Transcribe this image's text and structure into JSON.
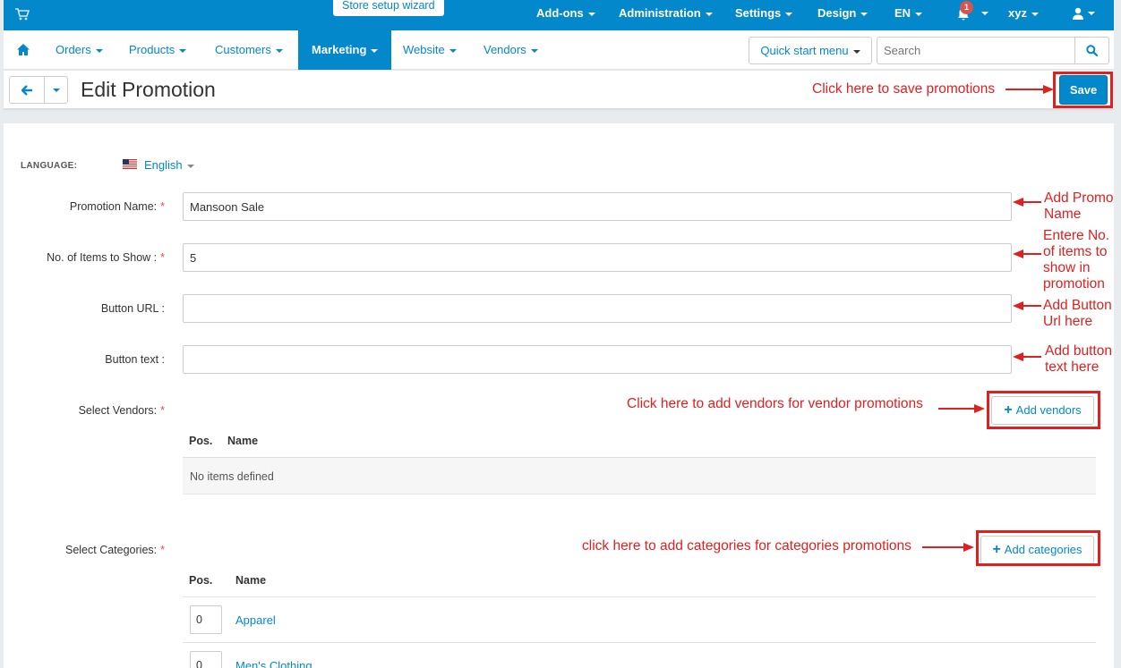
{
  "topbar": {
    "cart_icon": "shopping-cart-icon",
    "wizard_label": "Store setup wizard",
    "items": [
      {
        "label": "Add-ons"
      },
      {
        "label": "Administration"
      },
      {
        "label": "Settings"
      },
      {
        "label": "Design"
      },
      {
        "label": "EN"
      }
    ],
    "notification_count": "1",
    "user_name": "xyz"
  },
  "nav": {
    "home_icon": "home-icon",
    "items": [
      {
        "label": "Orders"
      },
      {
        "label": "Products"
      },
      {
        "label": "Customers"
      },
      {
        "label": "Marketing",
        "active": true
      },
      {
        "label": "Website"
      },
      {
        "label": "Vendors"
      }
    ],
    "quick_start": "Quick start menu",
    "search_placeholder": "Search"
  },
  "header": {
    "title": "Edit Promotion",
    "save_label": "Save"
  },
  "form": {
    "language_label": "LANGUAGE:",
    "language_value": "English",
    "promotion_name": {
      "label": "Promotion Name:",
      "value": "Mansoon Sale",
      "required": true
    },
    "items_to_show": {
      "label": "No. of Items to Show :",
      "value": "5",
      "required": true
    },
    "button_url": {
      "label": "Button URL :",
      "value": ""
    },
    "button_text": {
      "label": "Button text :",
      "value": ""
    },
    "vendors": {
      "label": "Select Vendors:",
      "add_label": "Add vendors",
      "col_pos": "Pos.",
      "col_name": "Name",
      "empty": "No items defined"
    },
    "categories": {
      "label": "Select Categories:",
      "add_label": "Add categories",
      "col_pos": "Pos.",
      "col_name": "Name",
      "rows": [
        {
          "pos": "0",
          "name": "Apparel"
        },
        {
          "pos": "0",
          "name": "Men's Clothing"
        }
      ]
    }
  },
  "annotations": {
    "save": "Click here to save promotions",
    "promo_name": [
      "Add Promo",
      "Name"
    ],
    "items": [
      "Entere No.",
      "of items to",
      "show in",
      "promotion"
    ],
    "button_url": [
      "Add Button",
      "Url here"
    ],
    "button_text": [
      "Add button",
      "text here"
    ],
    "vendors": "Click here to add vendors for vendor promotions",
    "categories": "click here to add categories for categories promotions"
  },
  "colors": {
    "brand_blue": "#0388cc",
    "annotation_red": "#e02020",
    "required_red": "#d9534f"
  }
}
